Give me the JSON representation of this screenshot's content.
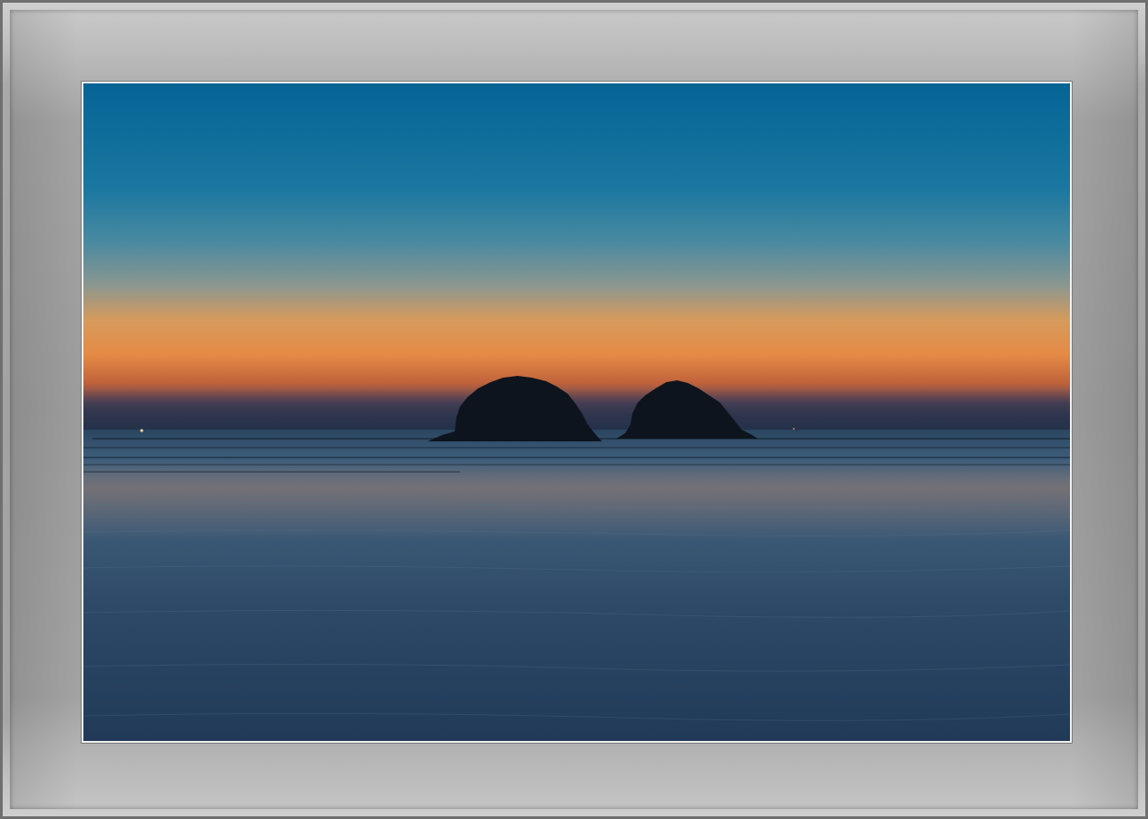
{
  "image": {
    "subject": "sunset-seascape",
    "colors": {
      "sky_top": "#066496",
      "sky_mid": "#3f86a3",
      "horizon_glow": "#e38d4a",
      "horizon_dark": "#1f3651",
      "water": "#2b4a66",
      "island": "#0e1620",
      "frame": "#a2a2a2",
      "photo_border": "#f2f2f2"
    }
  }
}
